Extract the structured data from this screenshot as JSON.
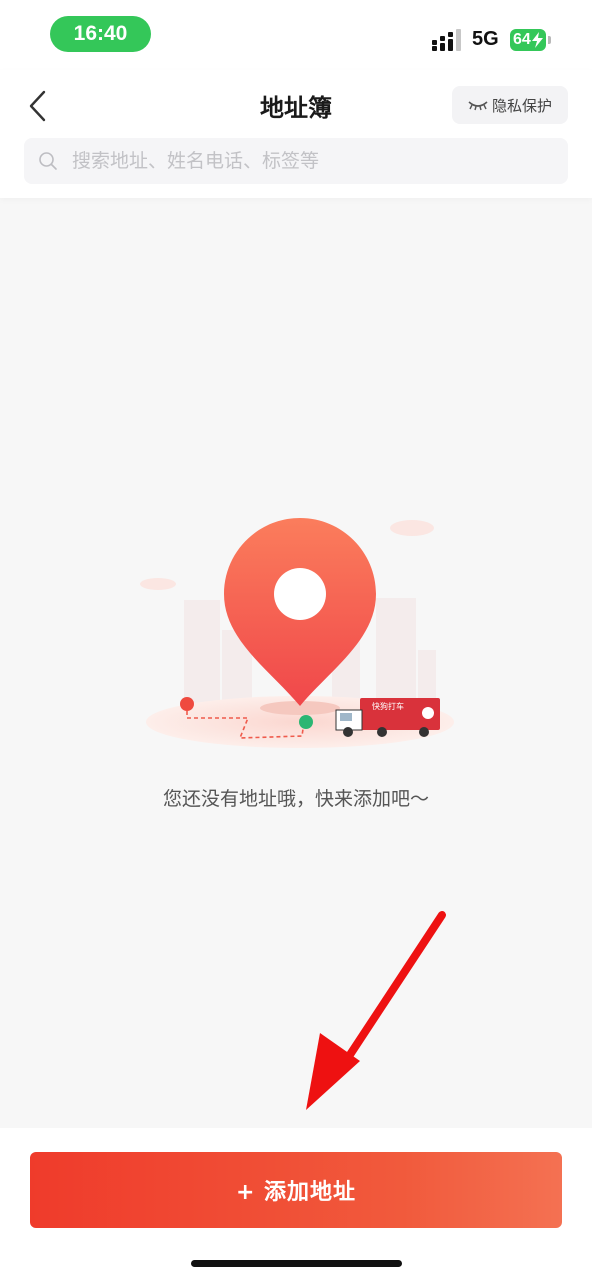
{
  "status_bar": {
    "time": "16:40",
    "network": "5G",
    "battery": "64",
    "time_pill_color": "#34c759"
  },
  "header": {
    "back_icon": "chevron-left-icon",
    "title": "地址簿",
    "privacy_label": "隐私保护",
    "privacy_icon": "closed-eye-icon"
  },
  "search": {
    "placeholder": "搜索地址、姓名电话、标签等",
    "value": "",
    "icon": "search-icon"
  },
  "empty_state": {
    "illustration": "location-pin-delivery-truck-illustration",
    "truck_sign": "快狗打车",
    "message": "您还没有地址哦，快来添加吧～"
  },
  "annotation": {
    "arrow_color": "#ee1111"
  },
  "bottom": {
    "add_button_label": "+ 添加地址",
    "accent_color": "#ef3b2b"
  }
}
